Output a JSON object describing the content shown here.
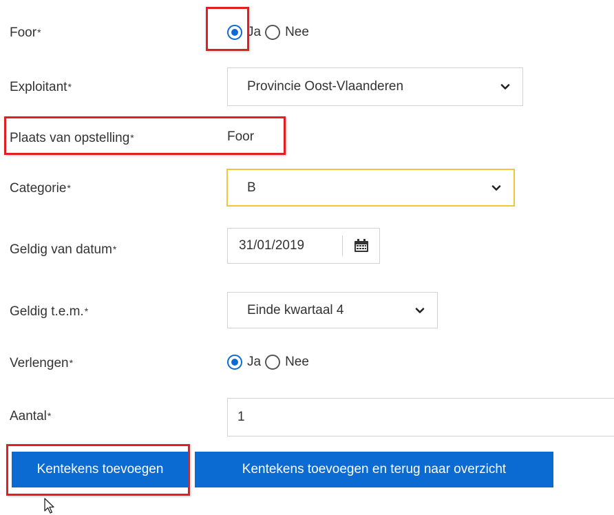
{
  "form": {
    "foor": {
      "label": "Foor",
      "required_mark": "*",
      "option_yes": "Ja",
      "option_no": "Nee",
      "selected": "Ja"
    },
    "exploitant": {
      "label": "Exploitant",
      "required_mark": "*",
      "value": "Provincie Oost-Vlaanderen"
    },
    "plaats": {
      "label": "Plaats van opstelling",
      "required_mark": "*",
      "value": "Foor"
    },
    "categorie": {
      "label": "Categorie",
      "required_mark": "*",
      "value": "B"
    },
    "geldig_van": {
      "label": "Geldig van datum",
      "required_mark": "*",
      "value": "31/01/2019"
    },
    "geldig_tem": {
      "label": "Geldig t.e.m.",
      "required_mark": "*",
      "value": "Einde kwartaal 4"
    },
    "verlengen": {
      "label": "Verlengen",
      "required_mark": "*",
      "option_yes": "Ja",
      "option_no": "Nee",
      "selected": "Ja"
    },
    "aantal": {
      "label": "Aantal",
      "required_mark": "*",
      "value": "1"
    }
  },
  "buttons": {
    "add": "Kentekens toevoegen",
    "add_and_back": "Kentekens toevoegen en terug naar overzicht"
  },
  "colors": {
    "primary": "#0b6bd3",
    "focus_border": "#f3c53b",
    "highlight": "#e02020"
  }
}
